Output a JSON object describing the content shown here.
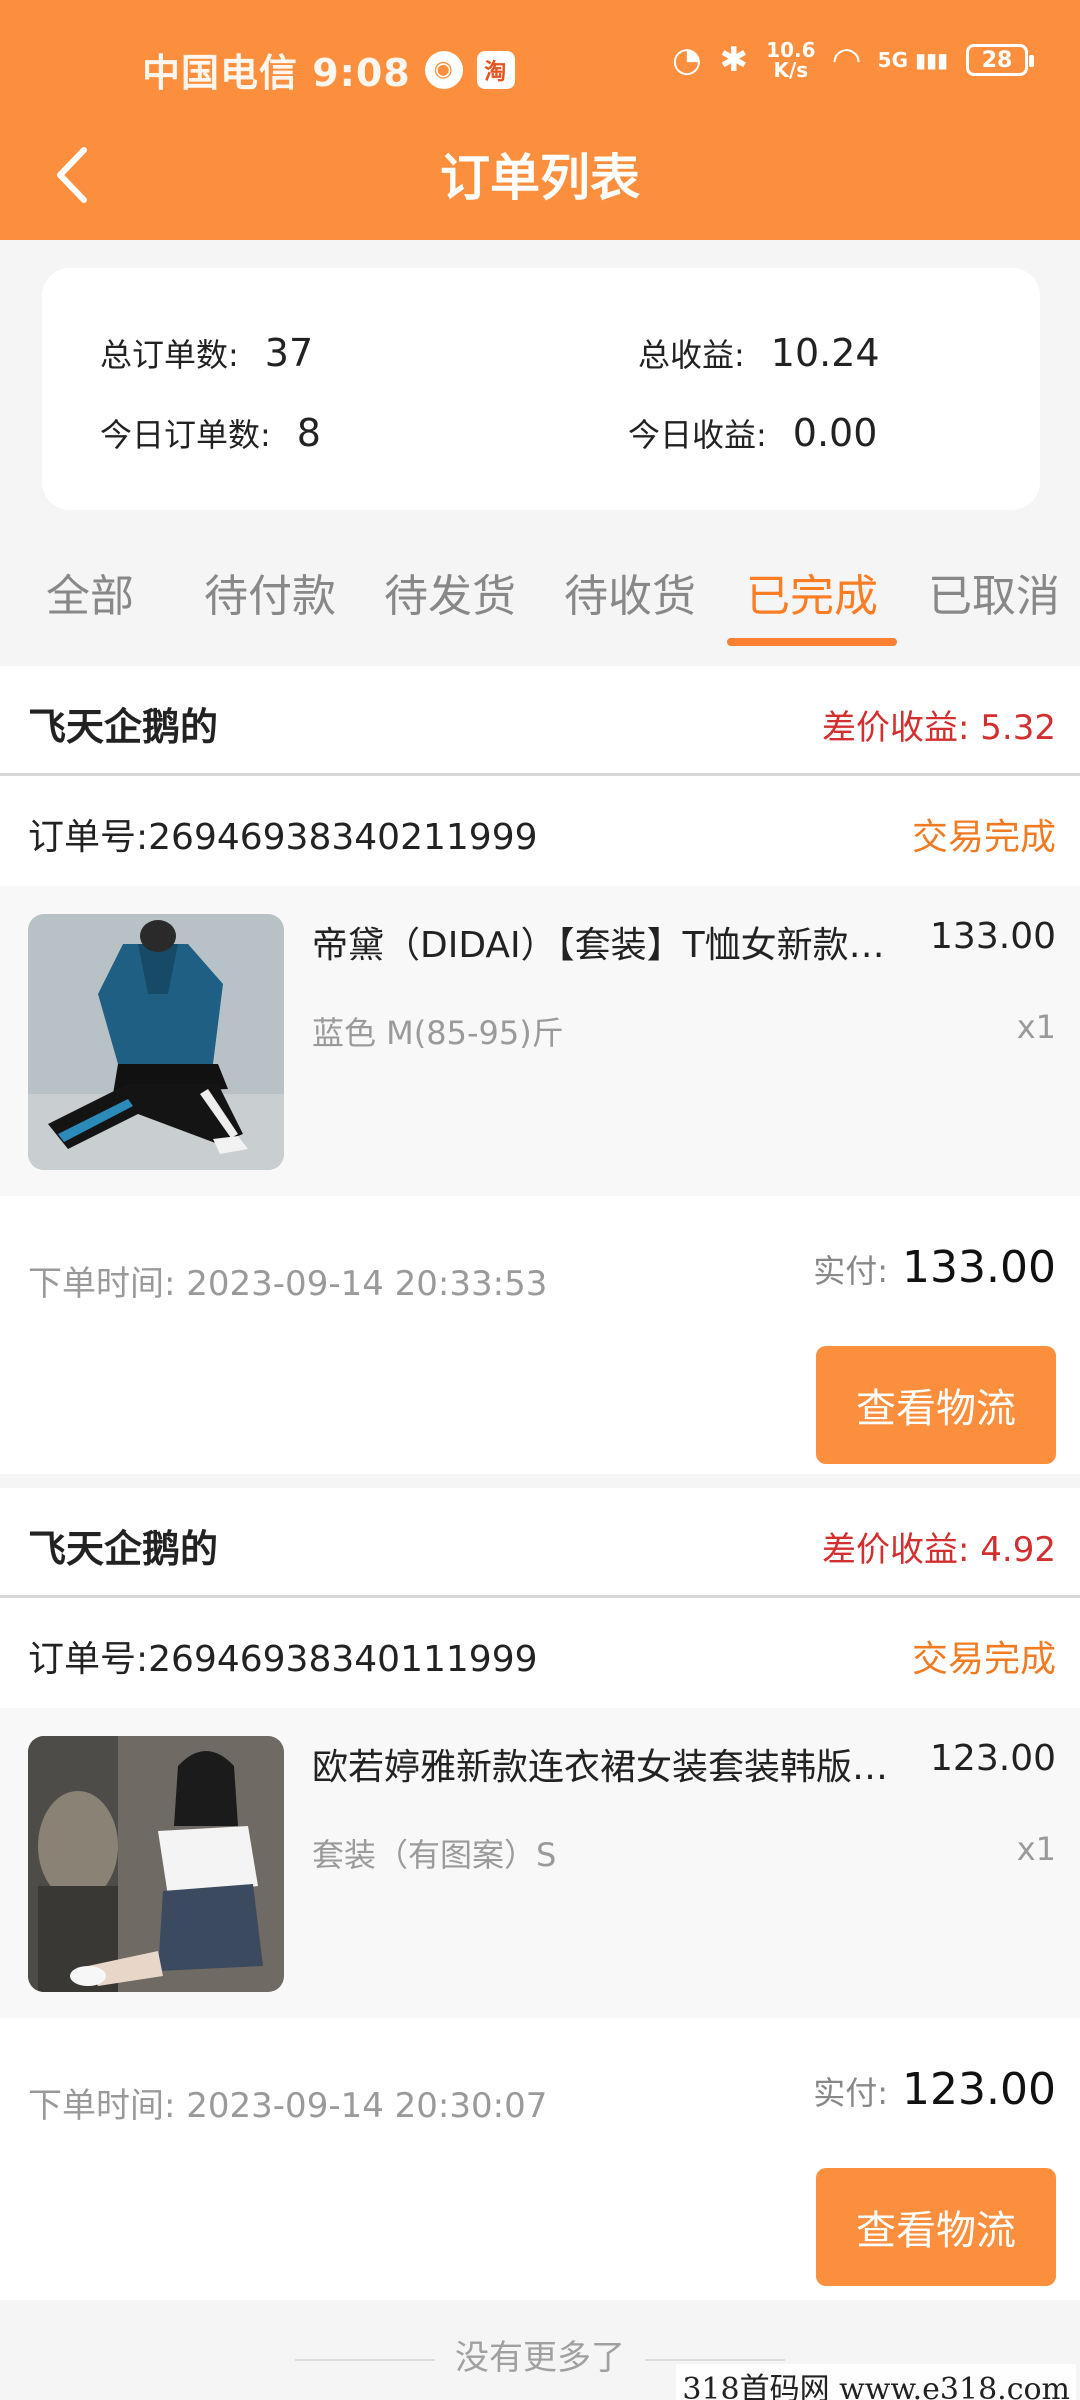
{
  "status_bar": {
    "carrier_time": "中国电信 9:08",
    "badge1": "◉",
    "badge2": "淘",
    "speed_top": "10.6",
    "speed_bottom": "K/s",
    "signal": "5G",
    "battery": "28"
  },
  "nav": {
    "title": "订单列表"
  },
  "summary": {
    "total_orders_label": "总订单数:",
    "total_orders_value": "37",
    "total_income_label": "总收益:",
    "total_income_value": "10.24",
    "today_orders_label": "今日订单数:",
    "today_orders_value": "8",
    "today_income_label": "今日收益:",
    "today_income_value": "0.00"
  },
  "tabs": [
    {
      "label": "全部"
    },
    {
      "label": "待付款"
    },
    {
      "label": "待发货"
    },
    {
      "label": "待收货"
    },
    {
      "label": "已完成"
    },
    {
      "label": "已取消"
    }
  ],
  "active_tab_index": 4,
  "orders": [
    {
      "shop": "飞天企鹅的",
      "profit": "差价收益: 5.32",
      "order_no": "订单号:26946938340211999",
      "status": "交易完成",
      "item_title": "帝黛（DIDAI）【套装】T恤女新款夏季运动套装",
      "item_price": "133.00",
      "item_spec": "蓝色 M(85-95)斤",
      "item_qty": "x1",
      "time": "下单时间: 2023-09-14 20:33:53",
      "paid_label": "实付:",
      "paid_value": "133.00",
      "button": "查看物流"
    },
    {
      "shop": "飞天企鹅的",
      "profit": "差价收益: 4.92",
      "order_no": "订单号:26946938340111999",
      "status": "交易完成",
      "item_title": "欧若婷雅新款连衣裙女装套装韩版时尚两件套",
      "item_price": "123.00",
      "item_spec": "套装（有图案）S",
      "item_qty": "x1",
      "time": "下单时间: 2023-09-14 20:30:07",
      "paid_label": "实付:",
      "paid_value": "123.00",
      "button": "查看物流"
    }
  ],
  "footer": {
    "no_more": "没有更多了",
    "watermark": "318首码网  www.e318.com"
  },
  "colors": {
    "accent": "#fc8f3d",
    "profit": "#d32f2f",
    "status": "#f07b22"
  }
}
